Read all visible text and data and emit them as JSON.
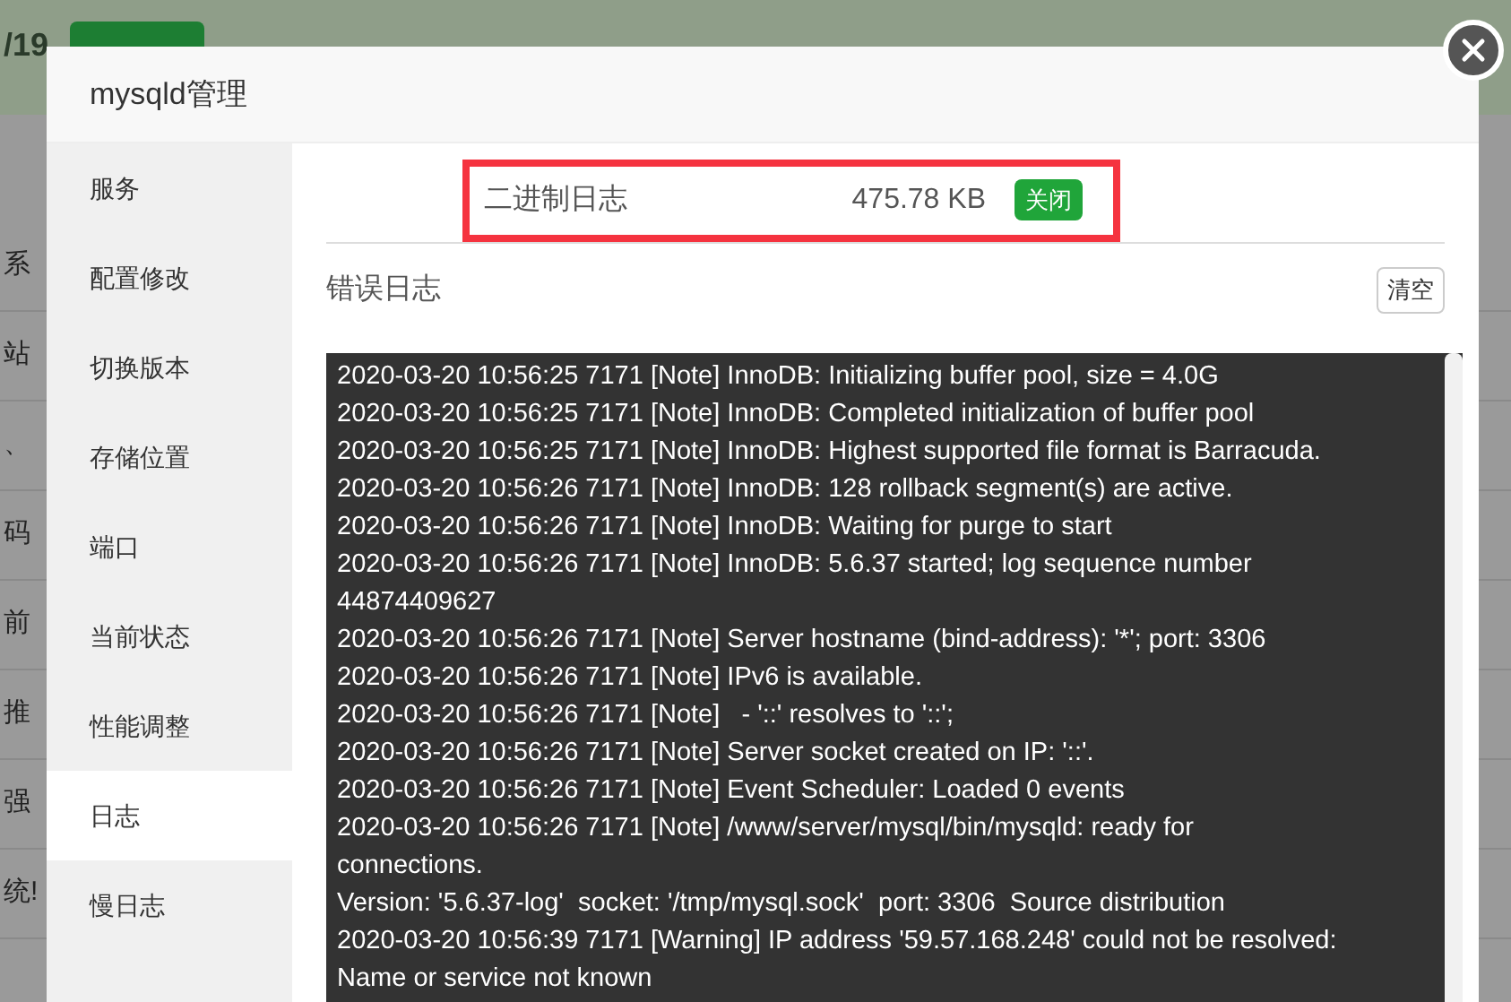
{
  "background_page": {
    "date_fragment": "/19",
    "row_fragments": [
      "系",
      "站",
      "、",
      "码",
      "前",
      "推",
      "强",
      "统!"
    ]
  },
  "dialog": {
    "title": "mysqld管理",
    "sidebar": [
      {
        "label": "服务",
        "selected": false
      },
      {
        "label": "配置修改",
        "selected": false
      },
      {
        "label": "切换版本",
        "selected": false
      },
      {
        "label": "存储位置",
        "selected": false
      },
      {
        "label": "端口",
        "selected": false
      },
      {
        "label": "当前状态",
        "selected": false
      },
      {
        "label": "性能调整",
        "selected": false
      },
      {
        "label": "日志",
        "selected": true
      },
      {
        "label": "慢日志",
        "selected": false
      }
    ],
    "binary_log": {
      "label": "二进制日志",
      "size": "475.78 KB",
      "button": "关闭",
      "highlighted": true
    },
    "error_log": {
      "title": "错误日志",
      "clear_button": "清空",
      "lines": [
        "2020-03-20 10:56:25 7171 [Note] InnoDB: Initializing buffer pool, size = 4.0G",
        "2020-03-20 10:56:25 7171 [Note] InnoDB: Completed initialization of buffer pool",
        "2020-03-20 10:56:25 7171 [Note] InnoDB: Highest supported file format is Barracuda.",
        "2020-03-20 10:56:26 7171 [Note] InnoDB: 128 rollback segment(s) are active.",
        "2020-03-20 10:56:26 7171 [Note] InnoDB: Waiting for purge to start",
        "2020-03-20 10:56:26 7171 [Note] InnoDB: 5.6.37 started; log sequence number",
        "44874409627",
        "2020-03-20 10:56:26 7171 [Note] Server hostname (bind-address): '*'; port: 3306",
        "2020-03-20 10:56:26 7171 [Note] IPv6 is available.",
        "2020-03-20 10:56:26 7171 [Note]   - '::' resolves to '::';",
        "2020-03-20 10:56:26 7171 [Note] Server socket created on IP: '::'.",
        "2020-03-20 10:56:26 7171 [Note] Event Scheduler: Loaded 0 events",
        "2020-03-20 10:56:26 7171 [Note] /www/server/mysql/bin/mysqld: ready for",
        "connections.",
        "Version: '5.6.37-log'  socket: '/tmp/mysql.sock'  port: 3306  Source distribution",
        "2020-03-20 10:56:39 7171 [Warning] IP address '59.57.168.248' could not be resolved:",
        "Name or service not known"
      ]
    }
  }
}
